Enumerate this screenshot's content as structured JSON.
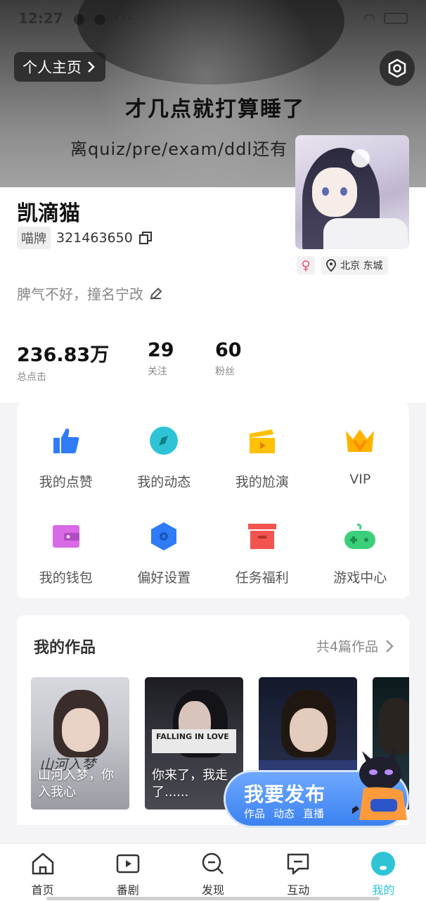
{
  "status_bar": {
    "time": "12:27"
  },
  "header": {
    "home_button_label": "个人主页",
    "cover_text_line1": "才几点就打算睡了",
    "cover_text_line2": "离quiz/pre/exam/ddl还有",
    "settings_icon": "settings-hexagon-icon"
  },
  "profile": {
    "nickname": "凯滴猫",
    "id_tag": "喵牌",
    "id_value": "321463650",
    "gender_symbol": "♀",
    "location": "北京 东城",
    "bio": "脾气不好，撞名宁改",
    "stats": [
      {
        "value": "236.83万",
        "label": "总点击"
      },
      {
        "value": "29",
        "label": "关注"
      },
      {
        "value": "60",
        "label": "粉丝"
      }
    ]
  },
  "menu": {
    "items": [
      {
        "label": "我的点赞",
        "icon": "thumbs-up-icon",
        "color": "#2f7cf6"
      },
      {
        "label": "我的动态",
        "icon": "compass-icon",
        "color": "#2ec4d6"
      },
      {
        "label": "我的尬演",
        "icon": "clapperboard-icon",
        "color": "#ffc107"
      },
      {
        "label": "VIP",
        "icon": "crown-icon",
        "color": "#ffb300"
      },
      {
        "label": "我的钱包",
        "icon": "wallet-icon",
        "color": "#d86ae6"
      },
      {
        "label": "偏好设置",
        "icon": "hexagon-settings-icon",
        "color": "#2f7cf6"
      },
      {
        "label": "任务福利",
        "icon": "gift-box-icon",
        "color": "#f2544f"
      },
      {
        "label": "游戏中心",
        "icon": "gamepad-icon",
        "color": "#3ccf7b"
      }
    ]
  },
  "works": {
    "title": "我的作品",
    "count_label": "共4篇作品",
    "items": [
      {
        "caption": "山河入梦，你入我心",
        "cover_text": "山河入梦"
      },
      {
        "caption": "你来了，我走了......",
        "cover_text": "FALLING IN LOVE"
      },
      {
        "caption": ""
      },
      {
        "caption": ""
      }
    ]
  },
  "publish": {
    "title": "我要发布",
    "options": [
      "作品",
      "动态",
      "直播"
    ]
  },
  "bottom_nav": {
    "items": [
      {
        "label": "首页",
        "icon": "home-icon",
        "active": false
      },
      {
        "label": "番剧",
        "icon": "play-icon",
        "active": false
      },
      {
        "label": "发现",
        "icon": "search-icon",
        "active": false
      },
      {
        "label": "互动",
        "icon": "message-icon",
        "active": false
      },
      {
        "label": "我的",
        "icon": "profile-icon",
        "active": true
      }
    ]
  },
  "colors": {
    "accent": "#2ec4d6",
    "publish_blue": "#3b82f0"
  }
}
